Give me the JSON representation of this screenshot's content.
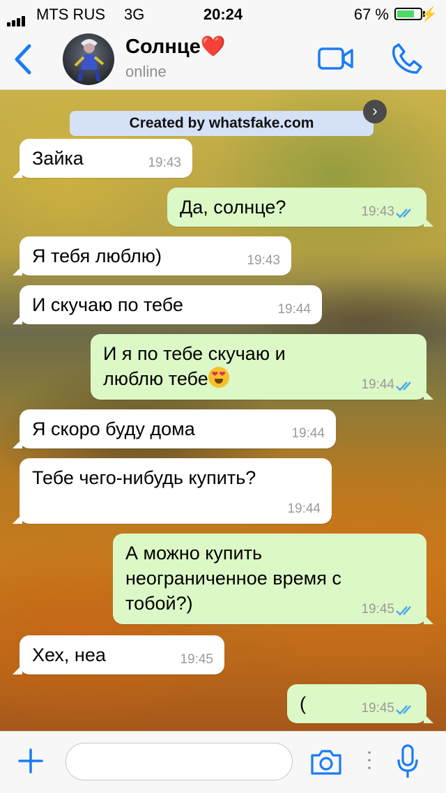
{
  "status_bar": {
    "carrier": "MTS RUS",
    "network": "3G",
    "time": "20:24",
    "battery": "67 %",
    "battery_level": 0.67
  },
  "header": {
    "contact_name": "Солнце",
    "heart": "❤️",
    "status": "online"
  },
  "banner": {
    "text": "Created by whatsfake.com",
    "close": "›"
  },
  "messages": [
    {
      "direction": "incoming",
      "lines": [
        "Зайка"
      ],
      "time": "19:43"
    },
    {
      "direction": "outgoing",
      "lines": [
        "Да, солнце?"
      ],
      "time": "19:43",
      "read": true
    },
    {
      "direction": "incoming",
      "lines": [
        "Я тебя люблю)"
      ],
      "time": "19:43"
    },
    {
      "direction": "incoming",
      "lines": [
        "И скучаю по тебе"
      ],
      "time": "19:44"
    },
    {
      "direction": "outgoing",
      "lines": [
        "И я по тебе скучаю и",
        "люблю тебе"
      ],
      "emoji": "heart-eyes",
      "time": "19:44",
      "read": true
    },
    {
      "direction": "incoming",
      "lines": [
        "Я скоро буду дома"
      ],
      "time": "19:44"
    },
    {
      "direction": "incoming",
      "lines": [
        "Тебе чего-нибудь купить?"
      ],
      "time": "19:44"
    },
    {
      "direction": "outgoing",
      "lines": [
        "А можно купить",
        "неограниченное время с",
        "тобой?)"
      ],
      "time": "19:45",
      "read": true
    },
    {
      "direction": "incoming",
      "lines": [
        "Хех, неа"
      ],
      "time": "19:45"
    },
    {
      "direction": "outgoing",
      "lines": [
        "("
      ],
      "time": "19:45",
      "read": true
    }
  ],
  "input": {
    "placeholder": ""
  },
  "colors": {
    "accent": "#1a7cf5",
    "outgoing_bubble": "#dcf8c6",
    "incoming_bubble": "#ffffff",
    "read_ticks": "#4fa8e8"
  }
}
